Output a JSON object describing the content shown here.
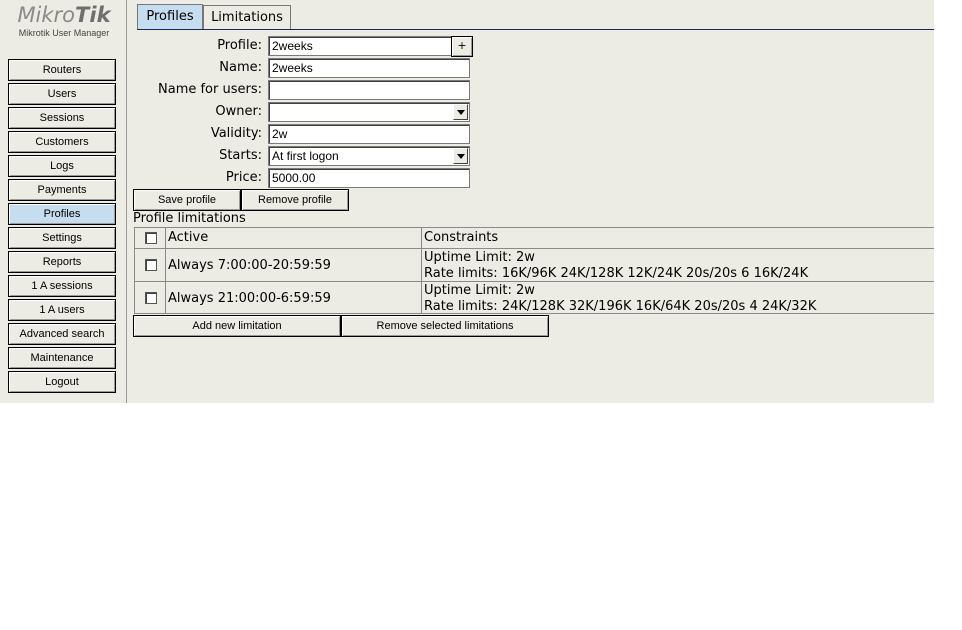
{
  "logo": {
    "brand_light": "Mikro",
    "brand_bold": "Tik",
    "subtitle": "Mikrotik User Manager"
  },
  "sidebar": {
    "items": [
      {
        "label": "Routers"
      },
      {
        "label": "Users"
      },
      {
        "label": "Sessions"
      },
      {
        "label": "Customers"
      },
      {
        "label": "Logs"
      },
      {
        "label": "Payments"
      },
      {
        "label": "Profiles",
        "active": true
      },
      {
        "label": "Settings"
      },
      {
        "label": "Reports"
      },
      {
        "label": "1 A sessions"
      },
      {
        "label": "1 A users"
      },
      {
        "label": "Advanced search"
      },
      {
        "label": "Maintenance"
      },
      {
        "label": "Logout"
      }
    ]
  },
  "tabs": [
    {
      "label": "Profiles",
      "active": true
    },
    {
      "label": "Limitations"
    }
  ],
  "form": {
    "profile": {
      "label": "Profile:",
      "value": "2weeks"
    },
    "add_label": "+",
    "name": {
      "label": "Name:",
      "value": "2weeks"
    },
    "name_for_users": {
      "label": "Name for users:",
      "value": ""
    },
    "owner": {
      "label": "Owner:",
      "value": ""
    },
    "validity": {
      "label": "Validity:",
      "value": "2w"
    },
    "starts": {
      "label": "Starts:",
      "value": "At first logon"
    },
    "price": {
      "label": "Price:",
      "value": "5000.00"
    }
  },
  "buttons": {
    "save_profile": "Save profile",
    "remove_profile": "Remove profile",
    "add_limitation": "Add new limitation",
    "remove_limitations": "Remove selected limitations"
  },
  "limitations": {
    "title": "Profile limitations",
    "headers": {
      "active": "Active",
      "constraints": "Constraints"
    },
    "rows": [
      {
        "active": "Always 7:00:00-20:59:59",
        "uptime": "Uptime Limit: 2w",
        "rate": "Rate limits: 16K/96K 24K/128K 12K/24K 20s/20s 6 16K/24K"
      },
      {
        "active": "Always 21:00:00-6:59:59",
        "uptime": "Uptime Limit: 2w",
        "rate": "Rate limits: 24K/128K 32K/196K 16K/64K 20s/20s 4 24K/32K"
      }
    ]
  },
  "colors": {
    "background": "#ecece4",
    "active": "#c6dcef",
    "tab_line": "#1a2b5a"
  }
}
